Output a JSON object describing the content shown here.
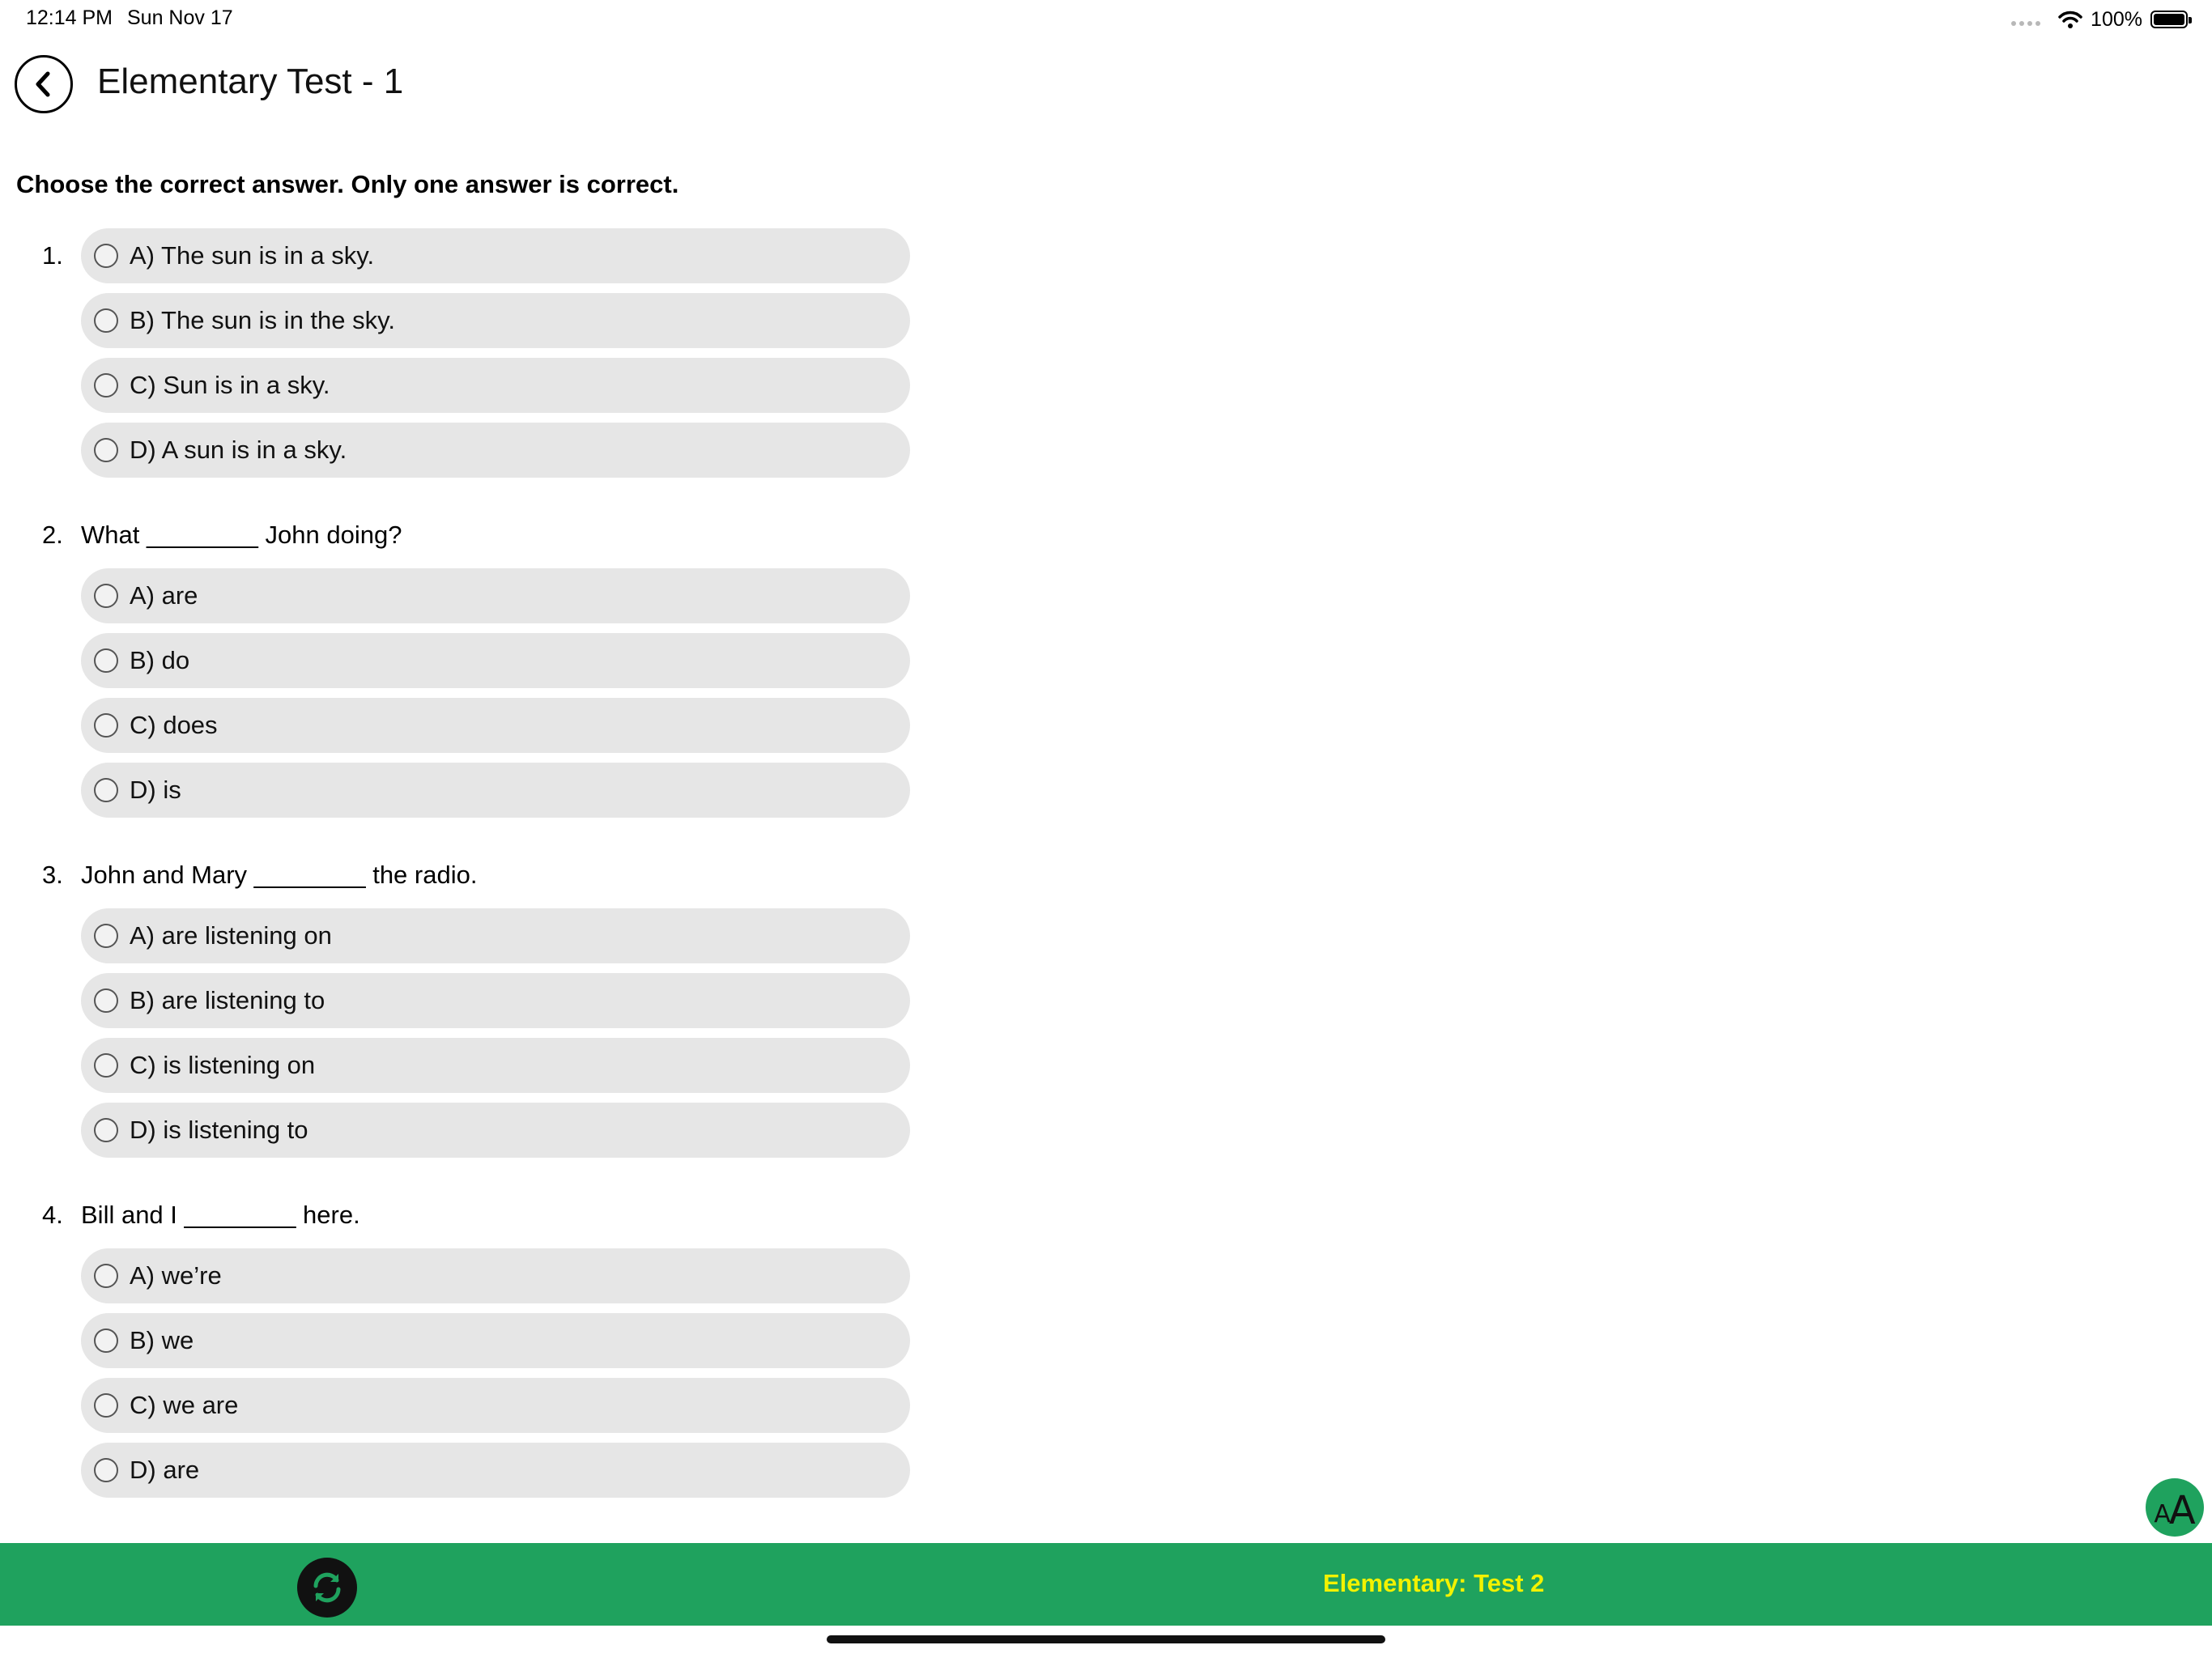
{
  "status_bar": {
    "time": "12:14 PM",
    "date": "Sun Nov 17",
    "battery_percent": "100%",
    "battery_level": 1.0,
    "icons": [
      "signal-dots-icon",
      "wifi-icon",
      "battery-icon"
    ]
  },
  "header": {
    "back_icon": "chevron-left-icon",
    "title": "Elementary Test - 1"
  },
  "instructions": "Choose the correct answer. Only one answer is correct.",
  "questions": [
    {
      "number": "1.",
      "text": "",
      "options": [
        "A) The sun is in a sky.",
        "B) The sun is in the sky.",
        "C) Sun is in a sky.",
        "D) A sun is in a sky."
      ],
      "selected": null
    },
    {
      "number": "2.",
      "text": "What ________ John doing?",
      "options": [
        "A) are",
        "B) do",
        "C) does",
        "D) is"
      ],
      "selected": null
    },
    {
      "number": "3.",
      "text": "John and Mary ________ the radio.",
      "options": [
        "A) are listening on",
        "B) are listening to",
        "C) is listening on",
        "D) is listening to"
      ],
      "selected": null
    },
    {
      "number": "4.",
      "text": "Bill and I ________ here.",
      "options": [
        "A) we’re",
        "B) we",
        "C) we are",
        "D) are"
      ],
      "selected": null
    }
  ],
  "font_size_button": {
    "icon": "text-size-icon",
    "small_label": "A",
    "large_label": "A"
  },
  "bottom_bar": {
    "refresh_icon": "refresh-icon",
    "next_test_label": "Elementary: Test 2",
    "background_color": "#1fa25e",
    "next_label_color": "#f2f200"
  }
}
